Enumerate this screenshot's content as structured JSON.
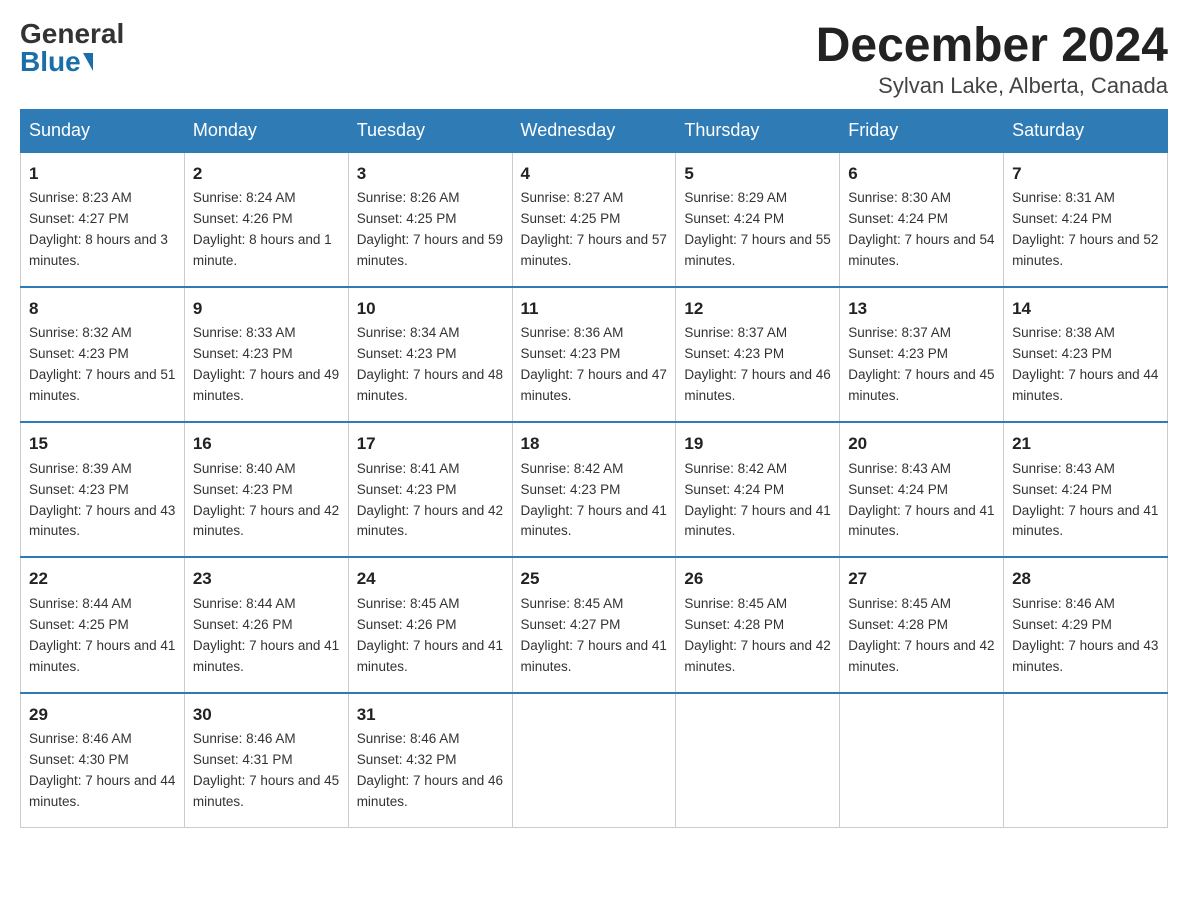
{
  "header": {
    "logo_general": "General",
    "logo_blue": "Blue",
    "month_title": "December 2024",
    "subtitle": "Sylvan Lake, Alberta, Canada"
  },
  "days_of_week": [
    "Sunday",
    "Monday",
    "Tuesday",
    "Wednesday",
    "Thursday",
    "Friday",
    "Saturday"
  ],
  "weeks": [
    [
      {
        "day": "1",
        "sunrise": "8:23 AM",
        "sunset": "4:27 PM",
        "daylight": "8 hours and 3 minutes."
      },
      {
        "day": "2",
        "sunrise": "8:24 AM",
        "sunset": "4:26 PM",
        "daylight": "8 hours and 1 minute."
      },
      {
        "day": "3",
        "sunrise": "8:26 AM",
        "sunset": "4:25 PM",
        "daylight": "7 hours and 59 minutes."
      },
      {
        "day": "4",
        "sunrise": "8:27 AM",
        "sunset": "4:25 PM",
        "daylight": "7 hours and 57 minutes."
      },
      {
        "day": "5",
        "sunrise": "8:29 AM",
        "sunset": "4:24 PM",
        "daylight": "7 hours and 55 minutes."
      },
      {
        "day": "6",
        "sunrise": "8:30 AM",
        "sunset": "4:24 PM",
        "daylight": "7 hours and 54 minutes."
      },
      {
        "day": "7",
        "sunrise": "8:31 AM",
        "sunset": "4:24 PM",
        "daylight": "7 hours and 52 minutes."
      }
    ],
    [
      {
        "day": "8",
        "sunrise": "8:32 AM",
        "sunset": "4:23 PM",
        "daylight": "7 hours and 51 minutes."
      },
      {
        "day": "9",
        "sunrise": "8:33 AM",
        "sunset": "4:23 PM",
        "daylight": "7 hours and 49 minutes."
      },
      {
        "day": "10",
        "sunrise": "8:34 AM",
        "sunset": "4:23 PM",
        "daylight": "7 hours and 48 minutes."
      },
      {
        "day": "11",
        "sunrise": "8:36 AM",
        "sunset": "4:23 PM",
        "daylight": "7 hours and 47 minutes."
      },
      {
        "day": "12",
        "sunrise": "8:37 AM",
        "sunset": "4:23 PM",
        "daylight": "7 hours and 46 minutes."
      },
      {
        "day": "13",
        "sunrise": "8:37 AM",
        "sunset": "4:23 PM",
        "daylight": "7 hours and 45 minutes."
      },
      {
        "day": "14",
        "sunrise": "8:38 AM",
        "sunset": "4:23 PM",
        "daylight": "7 hours and 44 minutes."
      }
    ],
    [
      {
        "day": "15",
        "sunrise": "8:39 AM",
        "sunset": "4:23 PM",
        "daylight": "7 hours and 43 minutes."
      },
      {
        "day": "16",
        "sunrise": "8:40 AM",
        "sunset": "4:23 PM",
        "daylight": "7 hours and 42 minutes."
      },
      {
        "day": "17",
        "sunrise": "8:41 AM",
        "sunset": "4:23 PM",
        "daylight": "7 hours and 42 minutes."
      },
      {
        "day": "18",
        "sunrise": "8:42 AM",
        "sunset": "4:23 PM",
        "daylight": "7 hours and 41 minutes."
      },
      {
        "day": "19",
        "sunrise": "8:42 AM",
        "sunset": "4:24 PM",
        "daylight": "7 hours and 41 minutes."
      },
      {
        "day": "20",
        "sunrise": "8:43 AM",
        "sunset": "4:24 PM",
        "daylight": "7 hours and 41 minutes."
      },
      {
        "day": "21",
        "sunrise": "8:43 AM",
        "sunset": "4:24 PM",
        "daylight": "7 hours and 41 minutes."
      }
    ],
    [
      {
        "day": "22",
        "sunrise": "8:44 AM",
        "sunset": "4:25 PM",
        "daylight": "7 hours and 41 minutes."
      },
      {
        "day": "23",
        "sunrise": "8:44 AM",
        "sunset": "4:26 PM",
        "daylight": "7 hours and 41 minutes."
      },
      {
        "day": "24",
        "sunrise": "8:45 AM",
        "sunset": "4:26 PM",
        "daylight": "7 hours and 41 minutes."
      },
      {
        "day": "25",
        "sunrise": "8:45 AM",
        "sunset": "4:27 PM",
        "daylight": "7 hours and 41 minutes."
      },
      {
        "day": "26",
        "sunrise": "8:45 AM",
        "sunset": "4:28 PM",
        "daylight": "7 hours and 42 minutes."
      },
      {
        "day": "27",
        "sunrise": "8:45 AM",
        "sunset": "4:28 PM",
        "daylight": "7 hours and 42 minutes."
      },
      {
        "day": "28",
        "sunrise": "8:46 AM",
        "sunset": "4:29 PM",
        "daylight": "7 hours and 43 minutes."
      }
    ],
    [
      {
        "day": "29",
        "sunrise": "8:46 AM",
        "sunset": "4:30 PM",
        "daylight": "7 hours and 44 minutes."
      },
      {
        "day": "30",
        "sunrise": "8:46 AM",
        "sunset": "4:31 PM",
        "daylight": "7 hours and 45 minutes."
      },
      {
        "day": "31",
        "sunrise": "8:46 AM",
        "sunset": "4:32 PM",
        "daylight": "7 hours and 46 minutes."
      },
      null,
      null,
      null,
      null
    ]
  ]
}
